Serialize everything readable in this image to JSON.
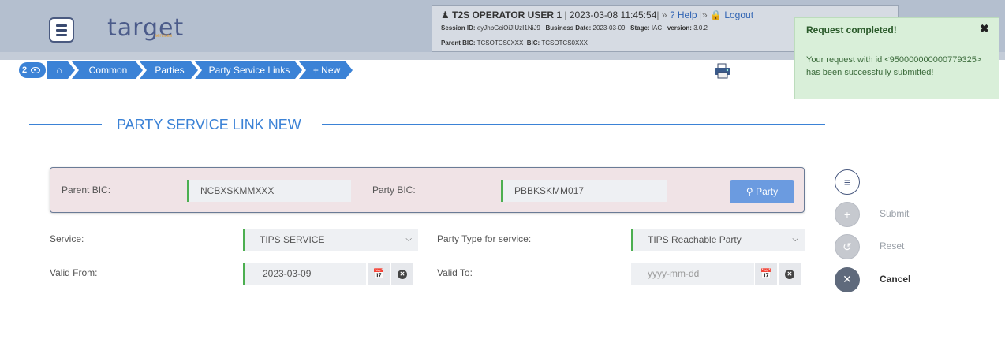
{
  "header": {
    "logo_text": "target",
    "logo_sub": "services",
    "user": "T2S OPERATOR USER 1",
    "datetime": "2023-03-08 11:45:54",
    "help": "Help",
    "logout": "Logout",
    "session_id_label": "Session ID:",
    "session_id": "eyJhbGciOiJIUzI1NiJ9",
    "business_date_label": "Business Date:",
    "business_date": "2023-03-09",
    "stage_label": "Stage:",
    "stage": "IAC",
    "version_label": "version:",
    "version": "3.0.2",
    "parent_bic_label": "Parent BIC:",
    "parent_bic": "TCSOTCS0XXX",
    "bic_label": "BIC:",
    "bic": "TCSOTCS0XXX"
  },
  "breadcrumb": {
    "count": "2",
    "items": [
      "Common",
      "Parties",
      "Party Service Links"
    ],
    "new": "+ New"
  },
  "toast": {
    "title": "Request completed!",
    "message": "Your request with id <950000000000779325> has been successfully submitted!"
  },
  "page": {
    "title": "PARTY SERVICE LINK NEW"
  },
  "search": {
    "parent_bic_label": "Parent BIC:",
    "parent_bic_value": "NCBXSKMMXXX",
    "party_bic_label": "Party BIC:",
    "party_bic_value": "PBBKSKMM017",
    "party_button": "Party"
  },
  "form": {
    "service_label": "Service:",
    "service_value": "TIPS SERVICE",
    "party_type_label": "Party Type for service:",
    "party_type_value": "TIPS Reachable Party",
    "valid_from_label": "Valid From:",
    "valid_from_value": "2023-03-09",
    "valid_to_label": "Valid To:",
    "valid_to_placeholder": "yyyy-mm-dd"
  },
  "actions": {
    "submit": "Submit",
    "reset": "Reset",
    "cancel": "Cancel"
  },
  "colors": {
    "accent": "#3b82d6",
    "required_marker": "#4caf50",
    "toast_bg": "#d9efd9"
  }
}
